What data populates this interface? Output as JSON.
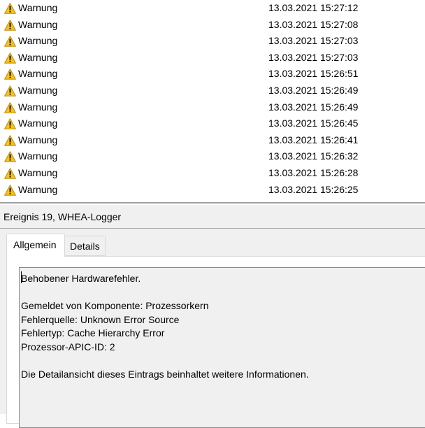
{
  "events": [
    {
      "level": "Warnung",
      "datetime": "13.03.2021 15:27:12"
    },
    {
      "level": "Warnung",
      "datetime": "13.03.2021 15:27:08"
    },
    {
      "level": "Warnung",
      "datetime": "13.03.2021 15:27:03"
    },
    {
      "level": "Warnung",
      "datetime": "13.03.2021 15:27:03"
    },
    {
      "level": "Warnung",
      "datetime": "13.03.2021 15:26:51"
    },
    {
      "level": "Warnung",
      "datetime": "13.03.2021 15:26:49"
    },
    {
      "level": "Warnung",
      "datetime": "13.03.2021 15:26:49"
    },
    {
      "level": "Warnung",
      "datetime": "13.03.2021 15:26:45"
    },
    {
      "level": "Warnung",
      "datetime": "13.03.2021 15:26:41"
    },
    {
      "level": "Warnung",
      "datetime": "13.03.2021 15:26:32"
    },
    {
      "level": "Warnung",
      "datetime": "13.03.2021 15:26:28"
    },
    {
      "level": "Warnung",
      "datetime": "13.03.2021 15:26:25"
    }
  ],
  "event_icon": "warning-icon",
  "colors": {
    "warning_fill": "#f6c31a",
    "warning_outline": "#c48a00"
  },
  "detail": {
    "title": "Ereignis 19, WHEA-Logger",
    "tabs": {
      "general": "Allgemein",
      "details": "Details"
    },
    "message": {
      "line1": "Behobener Hardwarefehler.",
      "line2": "Gemeldet von Komponente: Prozessorkern",
      "line3": "Fehlerquelle: Unknown Error Source",
      "line4": "Fehlertyp: Cache Hierarchy Error",
      "line5": "Prozessor-APIC-ID: 2",
      "line6": "Die Detailansicht dieses Eintrags beinhaltet weitere Informationen."
    }
  }
}
